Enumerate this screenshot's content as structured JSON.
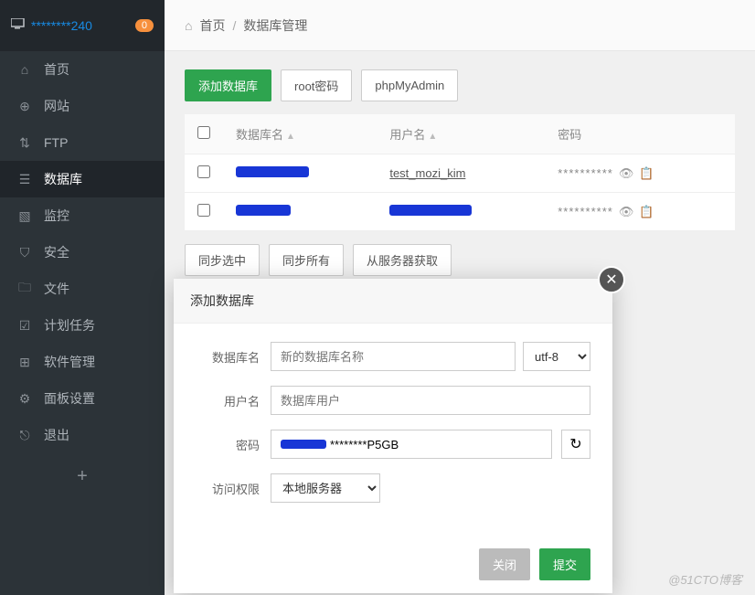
{
  "sidebar": {
    "ip": "********240",
    "badge": "0",
    "items": [
      {
        "label": "首页",
        "icon": "home"
      },
      {
        "label": "网站",
        "icon": "globe"
      },
      {
        "label": "FTP",
        "icon": "ftp"
      },
      {
        "label": "数据库",
        "icon": "database"
      },
      {
        "label": "监控",
        "icon": "monitor"
      },
      {
        "label": "安全",
        "icon": "shield"
      },
      {
        "label": "文件",
        "icon": "folder"
      },
      {
        "label": "计划任务",
        "icon": "calendar"
      },
      {
        "label": "软件管理",
        "icon": "grid"
      },
      {
        "label": "面板设置",
        "icon": "gear"
      },
      {
        "label": "退出",
        "icon": "exit"
      }
    ]
  },
  "breadcrumb": {
    "home": "首页",
    "current": "数据库管理"
  },
  "toolbar": {
    "add": "添加数据库",
    "rootpw": "root密码",
    "pma": "phpMyAdmin"
  },
  "table": {
    "headers": {
      "dbname": "数据库名",
      "username": "用户名",
      "password": "密码"
    },
    "rows": [
      {
        "dbname": "(redacted)",
        "username": "test_mozi_kim",
        "password": "**********"
      },
      {
        "dbname": "(redacted)",
        "username": "(redacted)",
        "password": "**********"
      }
    ]
  },
  "bottom": {
    "sync_selected": "同步选中",
    "sync_all": "同步所有",
    "fetch": "从服务器获取"
  },
  "modal": {
    "title": "添加数据库",
    "labels": {
      "dbname": "数据库名",
      "username": "用户名",
      "password": "密码",
      "access": "访问权限"
    },
    "placeholders": {
      "dbname": "新的数据库名称",
      "username": "数据库用户"
    },
    "values": {
      "password": "********P5GB",
      "charset": "utf-8",
      "access": "本地服务器"
    },
    "buttons": {
      "close": "关闭",
      "submit": "提交"
    }
  },
  "watermark": "@51CTO博客"
}
